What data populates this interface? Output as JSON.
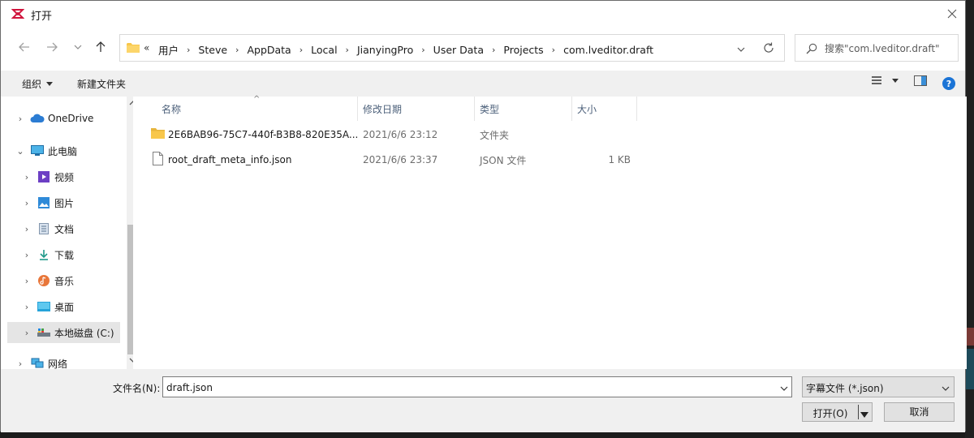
{
  "window": {
    "title": "打开",
    "close_icon": "close-icon"
  },
  "nav": {
    "back_icon": "arrow-left-icon",
    "forward_icon": "arrow-right-icon",
    "recent_icon": "chevron-down-icon",
    "up_icon": "arrow-up-icon",
    "overflow": "«",
    "breadcrumbs": [
      "用户",
      "Steve",
      "AppData",
      "Local",
      "JianyingPro",
      "User Data",
      "Projects",
      "com.lveditor.draft"
    ],
    "search_placeholder": "搜索\"com.lveditor.draft\""
  },
  "toolbar": {
    "organize": "组织",
    "new_folder": "新建文件夹",
    "view_icon": "list-view-icon",
    "preview_icon": "preview-pane-icon",
    "help_icon": "help-icon"
  },
  "sidebar": {
    "items": [
      {
        "label": "OneDrive",
        "icon": "cloud-icon"
      },
      {
        "label": "此电脑",
        "icon": "computer-icon"
      },
      {
        "label": "视频",
        "icon": "video-icon"
      },
      {
        "label": "图片",
        "icon": "picture-icon"
      },
      {
        "label": "文档",
        "icon": "document-icon"
      },
      {
        "label": "下载",
        "icon": "download-icon"
      },
      {
        "label": "音乐",
        "icon": "music-icon"
      },
      {
        "label": "桌面",
        "icon": "desktop-icon"
      },
      {
        "label": "本地磁盘 (C:)",
        "icon": "drive-icon"
      },
      {
        "label": "网络",
        "icon": "network-icon"
      }
    ]
  },
  "columns": {
    "name": "名称",
    "date": "修改日期",
    "type": "类型",
    "size": "大小"
  },
  "files": [
    {
      "name": "2E6BAB96-75C7-440f-B3B8-820E35A...",
      "date": "2021/6/6 23:12",
      "type": "文件夹",
      "size": "",
      "icon": "folder-icon"
    },
    {
      "name": "root_draft_meta_info.json",
      "date": "2021/6/6 23:37",
      "type": "JSON 文件",
      "size": "1 KB",
      "icon": "file-icon"
    }
  ],
  "footer": {
    "filename_label": "文件名(N):",
    "filename_value": "draft.json",
    "filetype_value": "字幕文件 (*.json)",
    "open_button": "打开(O)",
    "cancel_button": "取消"
  },
  "colors": {
    "accent": "#0078d7",
    "folder": "#f8c74b",
    "selected": "#e5e5e5"
  }
}
